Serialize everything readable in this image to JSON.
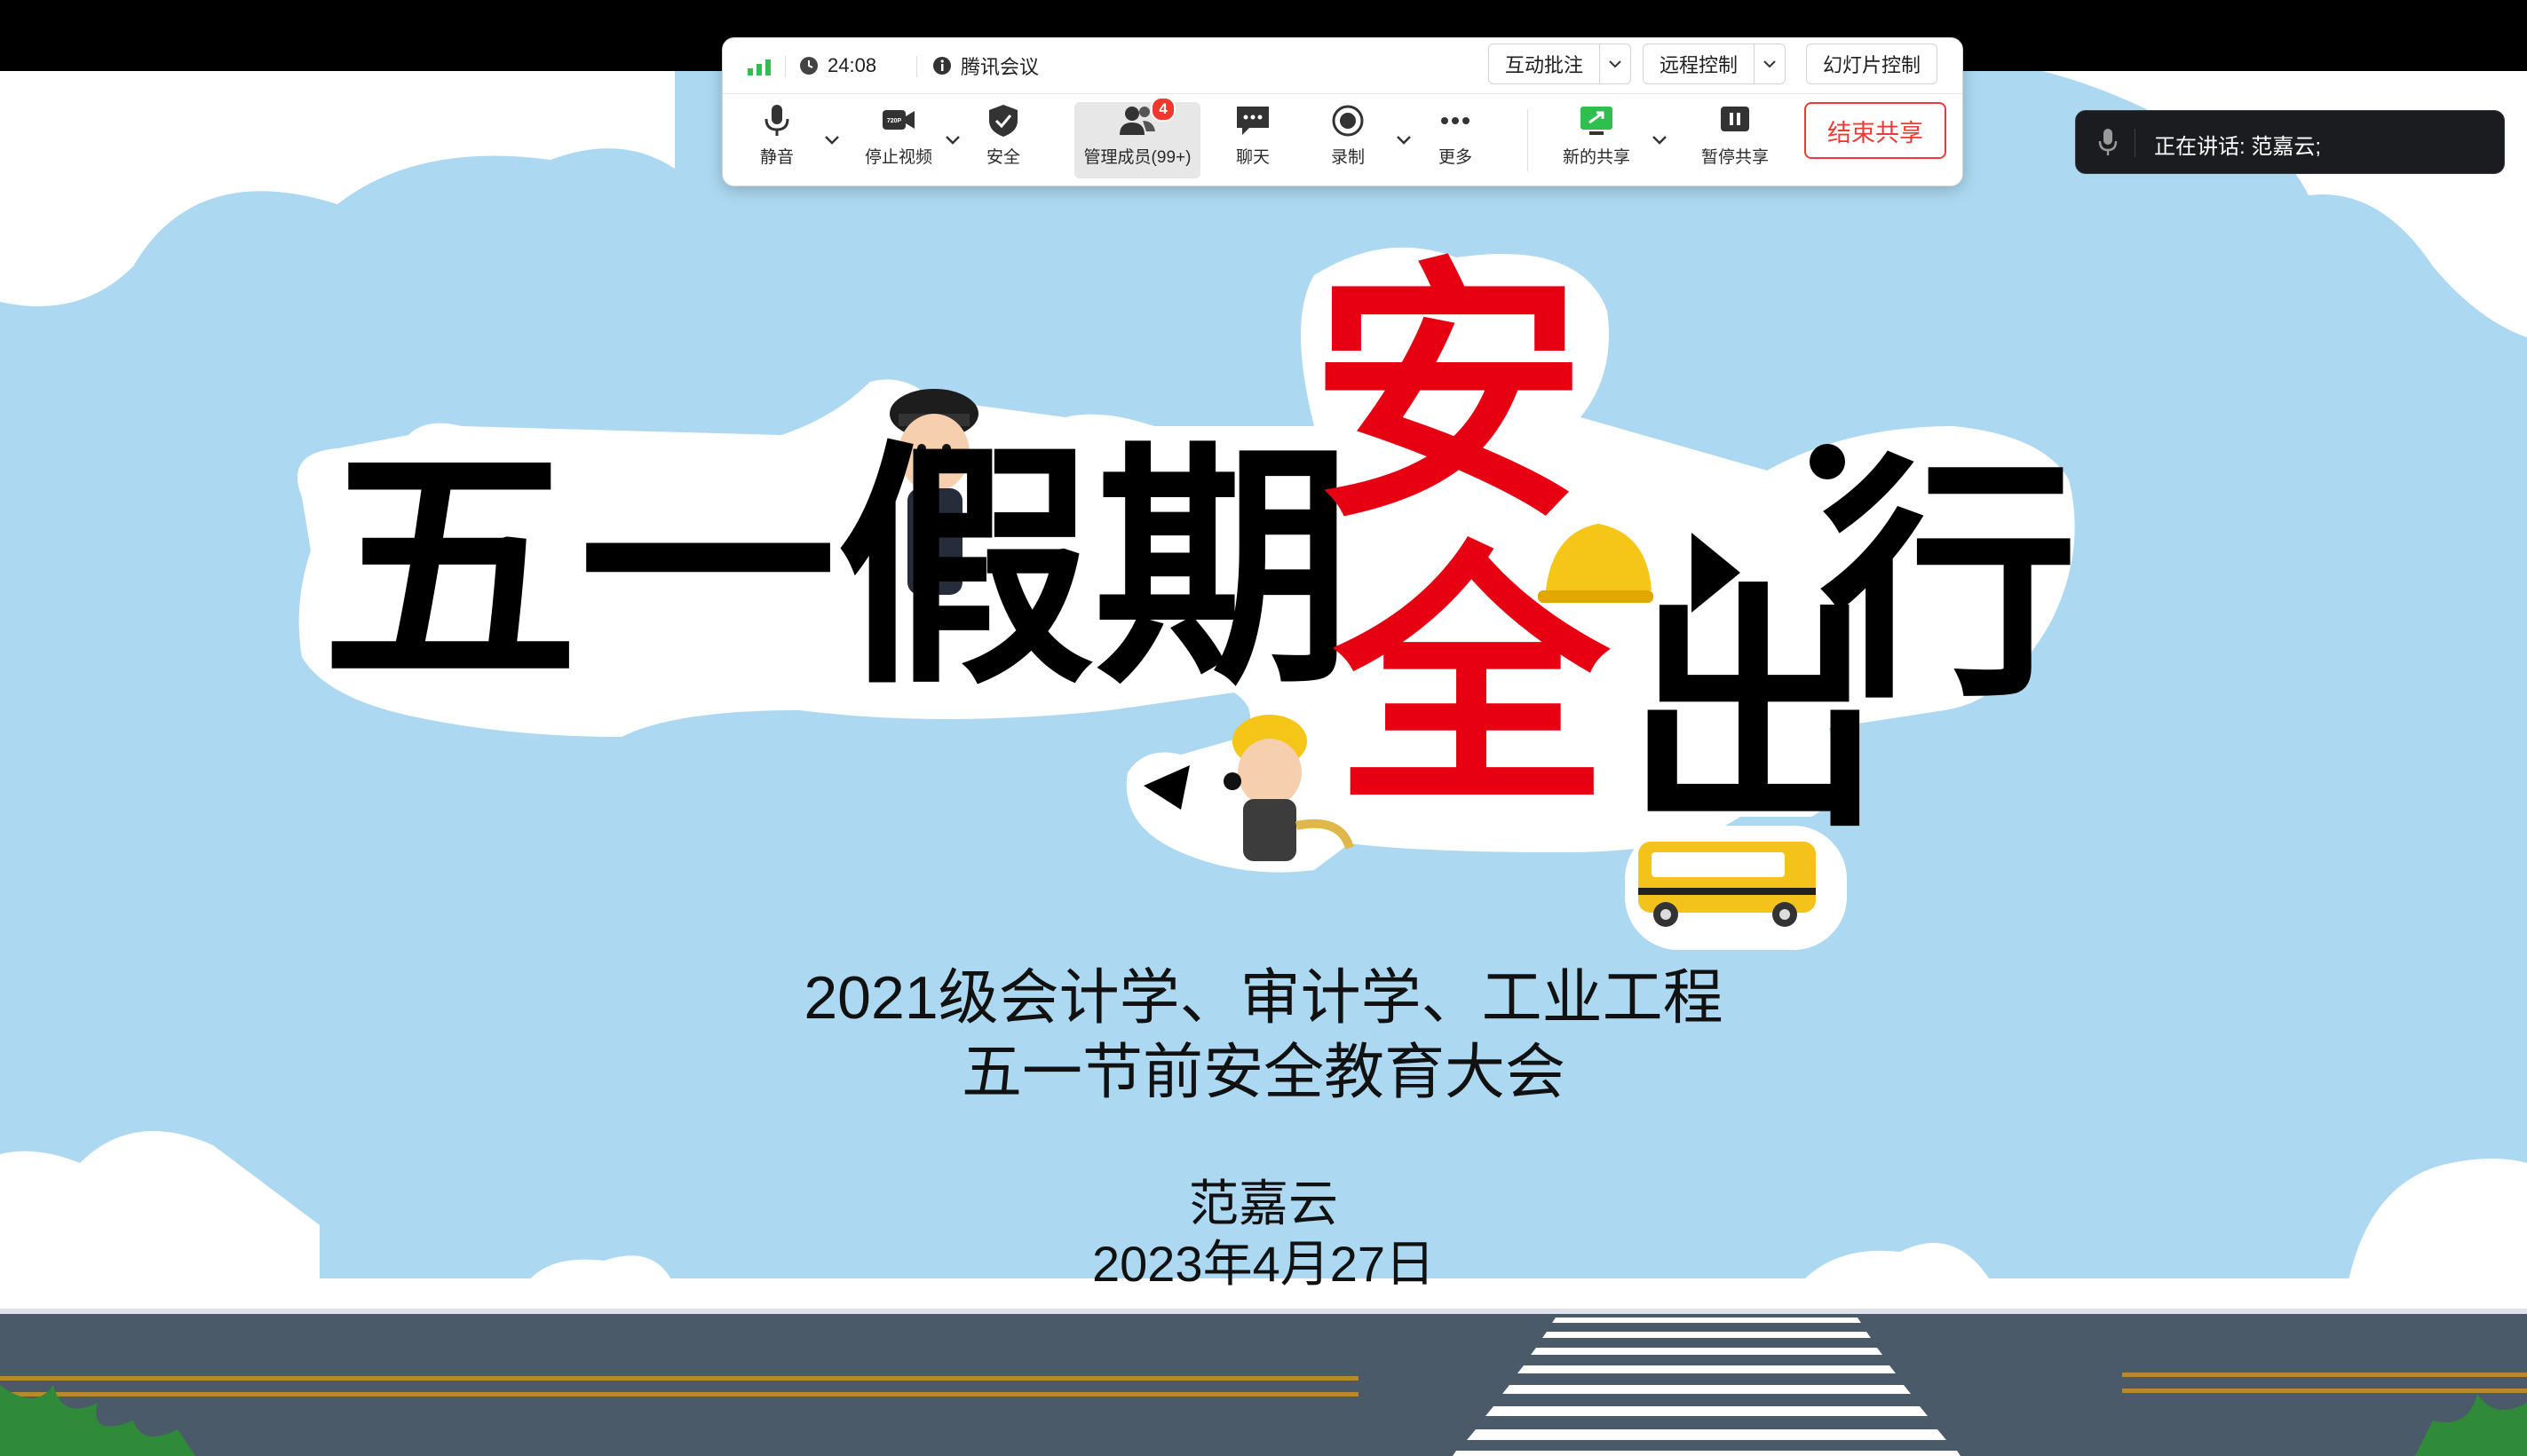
{
  "meeting": {
    "timer": "24:08",
    "app_name": "腾讯会议",
    "top_buttons": [
      "互动批注",
      "远程控制",
      "幻灯片控制"
    ],
    "tools": {
      "mute": "静音",
      "stop_video": "停止视频",
      "video_quality": "720P",
      "security": "安全",
      "members": "管理成员(99+)",
      "members_badge": "4",
      "chat": "聊天",
      "record": "录制",
      "more": "更多",
      "new_share": "新的共享",
      "pause_share": "暂停共享",
      "end_share": "结束共享"
    },
    "speaking": "正在讲话:  范嘉云;",
    "icons": [
      "signal-icon",
      "clock-icon",
      "info-icon",
      "mic-icon",
      "camera-icon",
      "shield-icon",
      "members-icon",
      "chat-icon",
      "record-icon",
      "more-icon",
      "share-screen-icon",
      "pause-icon",
      "chevron-down-icon"
    ],
    "colors": {
      "accent_red": "#ee3a35",
      "signal_green": "#2fbf4f",
      "badge_red": "#f0392c"
    }
  },
  "slide": {
    "title_black_1": "五一假期",
    "title_red_1": "安",
    "title_red_2": "全",
    "title_black_2": "出",
    "title_black_3": "行",
    "subtitle_line1": "2021级会计学、审计学、工业工程",
    "subtitle_line2": "五一节前安全教育大会",
    "presenter": "范嘉云",
    "date": "2023年4月27日",
    "colors": {
      "sky": "#acd9f1",
      "road": "#4b5a68",
      "title_red": "#e60012"
    }
  }
}
